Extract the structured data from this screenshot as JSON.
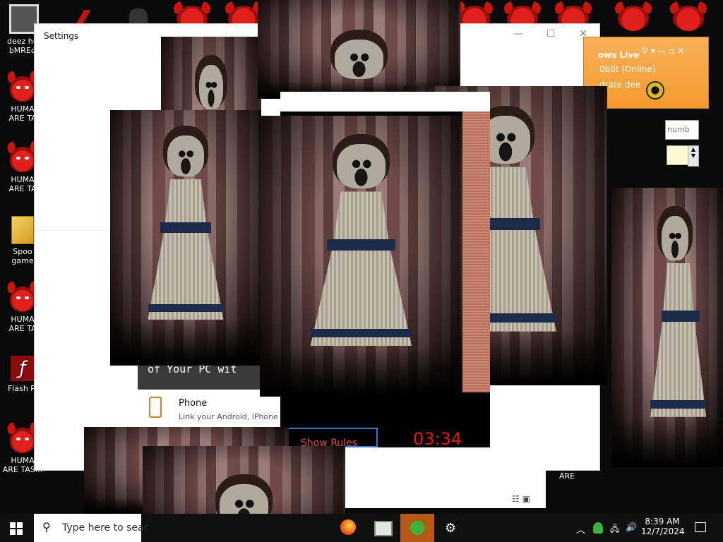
{
  "desktop": {
    "icons": [
      {
        "label": "deez hut\nbMREqt",
        "kind": "app"
      },
      {
        "label": "HUMA\nARE TA",
        "kind": "demon"
      },
      {
        "label": "HUMA\nARE TA",
        "kind": "demon"
      },
      {
        "label": "Spoo\ngame",
        "kind": "folder"
      },
      {
        "label": "HUMA\nARE TA",
        "kind": "demon"
      },
      {
        "label": "Flash Pl",
        "kind": "flash"
      },
      {
        "label": "HUMA\nARE TAS...",
        "kind": "demon"
      }
    ],
    "right_label": "ARE"
  },
  "settings": {
    "title": "Settings",
    "banner_text": "of Your PC wit",
    "phone": {
      "title": "Phone",
      "subtitle": "Link your Android, iPhone"
    }
  },
  "game": {
    "show_rules_label": "Show Rules",
    "timer": "03:34"
  },
  "msn": {
    "title": "ows Live",
    "status": "0b0t (Online)",
    "message": "drate dee",
    "input_placeholder": "numb"
  },
  "taskbar": {
    "search_placeholder": "Type here to sear",
    "time": "8:39 AM",
    "date": "12/7/2024"
  }
}
